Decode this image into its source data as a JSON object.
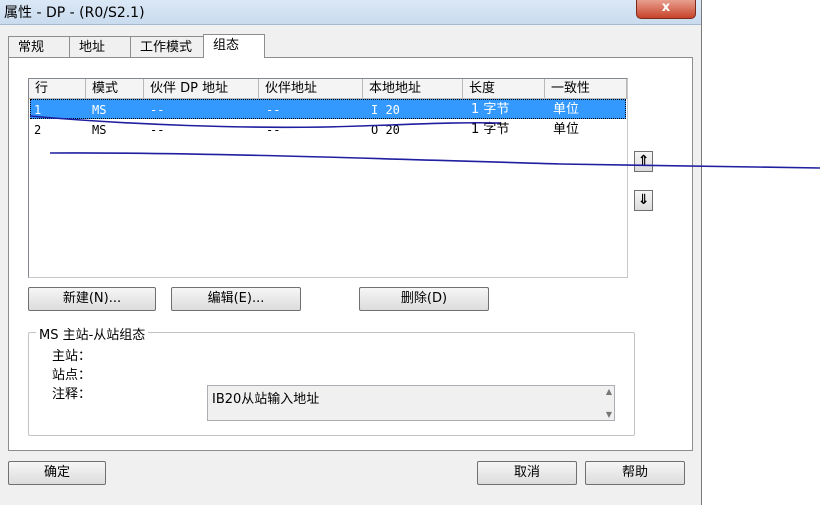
{
  "window": {
    "title": "属性 - DP - (R0/S2.1)",
    "close_glyph": "x"
  },
  "tabs": [
    {
      "label": "常规",
      "active": false
    },
    {
      "label": "地址",
      "active": false
    },
    {
      "label": "工作模式",
      "active": false
    },
    {
      "label": "组态",
      "active": true
    }
  ],
  "table": {
    "columns": [
      "行",
      "模式",
      "伙伴 DP 地址",
      "伙伴地址",
      "本地地址",
      "长度",
      "一致性"
    ],
    "rows": [
      {
        "row": "1",
        "mode": "MS",
        "partner_dp": "--",
        "partner_addr": "--",
        "local_addr": "I 20",
        "length": "1 字节",
        "consistency": "单位",
        "selected": true
      },
      {
        "row": "2",
        "mode": "MS",
        "partner_dp": "--",
        "partner_addr": "--",
        "local_addr": "O 20",
        "length": "1 字节",
        "consistency": "单位",
        "selected": false
      }
    ]
  },
  "arrows": {
    "up": "⇑",
    "down": "⇓"
  },
  "buttons": {
    "new": "新建(N)...",
    "edit": "编辑(E)...",
    "delete": "删除(D)"
  },
  "group": {
    "title": "MS 主站-从站组态",
    "master_label": "主站：",
    "station_label": "站点：",
    "comment_label": "注释：",
    "comment_value": "IB20从站输入地址"
  },
  "footer": {
    "ok": "确定",
    "cancel": "取消",
    "help": "帮助"
  },
  "colors": {
    "selection": "#3399ff",
    "annotation_ink": "#1f1fa0",
    "close_button": "#c7432b"
  }
}
